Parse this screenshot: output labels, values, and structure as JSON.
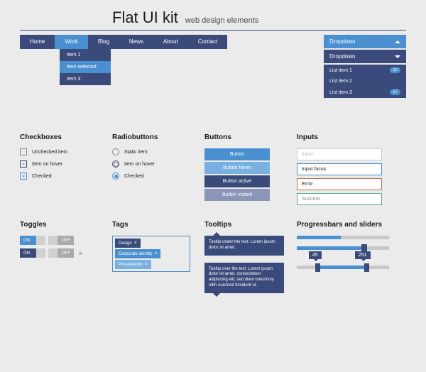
{
  "header": {
    "title": "Flat UI kit",
    "subtitle": "web design elements"
  },
  "nav": {
    "items": [
      "Home",
      "Work",
      "Blog",
      "News",
      "About",
      "Contact"
    ],
    "active": 1,
    "dropdown": [
      "Item 1",
      "Item selected",
      "Item 3"
    ],
    "selected": 1
  },
  "dropdowns": {
    "label": "Dropdown",
    "list": [
      {
        "label": "List item 1",
        "badge": "12"
      },
      {
        "label": "List item 2",
        "badge": null
      },
      {
        "label": "List item 3",
        "badge": "17"
      }
    ]
  },
  "checkboxes": {
    "title": "Checkboxes",
    "items": [
      "Unchecked item",
      "Item on hover",
      "Checked"
    ]
  },
  "radios": {
    "title": "Radiobuttons",
    "items": [
      "Static item",
      "Item on hover",
      "Checked"
    ]
  },
  "buttons": {
    "title": "Buttons",
    "items": [
      "Button",
      "Button hover",
      "Button active",
      "Button visited"
    ]
  },
  "inputs": {
    "title": "Inputs",
    "items": [
      "Input",
      "Input focus",
      "Error",
      "Success"
    ]
  },
  "toggles": {
    "title": "Toggles",
    "on": "ON",
    "off": "OFF"
  },
  "tags": {
    "title": "Tags",
    "items": [
      "Design",
      "Corporate identity",
      "Presentation"
    ]
  },
  "tooltips": {
    "title": "Tooltips",
    "t1": "Tooltip under the text. Lorem ipsum dolor sit amet.",
    "t2": "Tooltip over the text. Lorem ipsum dolor sit amet, consectetuer adipiscing elit, sed diam nonummy nibh euismod tincidunt ut."
  },
  "progress": {
    "title": "Progressbars and sliders",
    "v1": "45",
    "v2": "251"
  }
}
